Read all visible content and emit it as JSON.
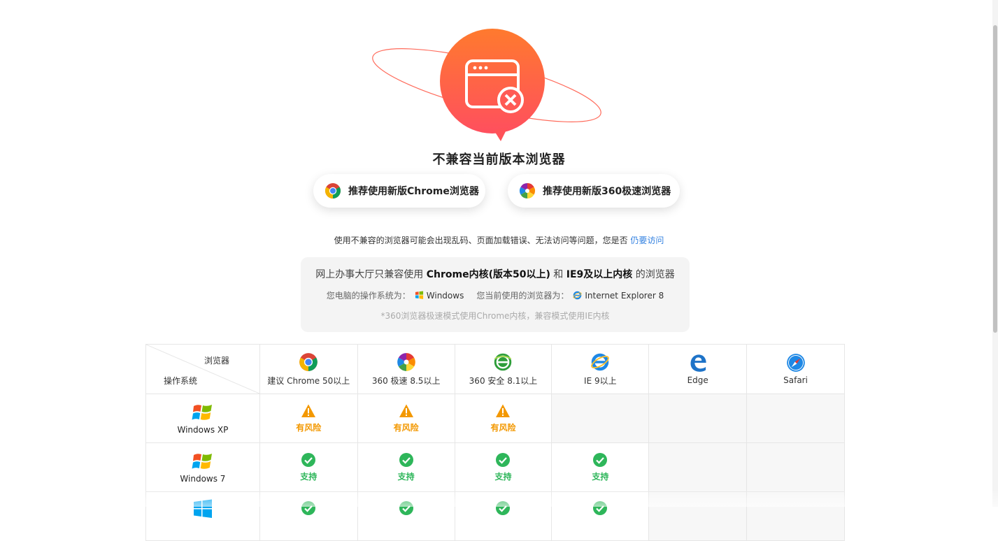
{
  "title": "不兼容当前版本浏览器",
  "buttons": {
    "chrome": "推荐使用新版Chrome浏览器",
    "b360": "推荐使用新版360极速浏览器"
  },
  "notice": {
    "text": "使用不兼容的浏览器可能会出现乱码、页面加载错误、无法访问等问题，您是否",
    "link": "仍要访问"
  },
  "info": {
    "pre": "网上办事大厅只兼容使用 ",
    "b1": "Chrome内核(版本50以上)",
    "mid": " 和 ",
    "b2": "IE9及以上内核",
    "post": " 的浏览器",
    "os_label": "您电脑的操作系统为：",
    "os_value": "Windows",
    "browser_label": "您当前使用的浏览器为：",
    "browser_value": "Internet Explorer 8",
    "footnote": "*360浏览器极速模式使用Chrome内核，兼容模式使用IE内核"
  },
  "table": {
    "corner_browser": "浏览器",
    "corner_os": "操作系统",
    "columns": [
      {
        "label": "建议 Chrome 50以上",
        "icon": "chrome-icon"
      },
      {
        "label": "360 极速 8.5以上",
        "icon": "360-speed-icon"
      },
      {
        "label": "360 安全 8.1以上",
        "icon": "360-safe-icon"
      },
      {
        "label": "IE 9以上",
        "icon": "ie-icon"
      },
      {
        "label": "Edge",
        "icon": "edge-icon"
      },
      {
        "label": "Safari",
        "icon": "safari-icon"
      }
    ],
    "rows": [
      {
        "os": "Windows XP",
        "cells": [
          "risk",
          "risk",
          "risk",
          "none",
          "none",
          "none"
        ]
      },
      {
        "os": "Windows 7",
        "cells": [
          "ok",
          "ok",
          "ok",
          "ok",
          "none",
          "none"
        ]
      },
      {
        "os": "",
        "cells": [
          "ok",
          "ok",
          "ok",
          "ok",
          "none",
          "none"
        ]
      }
    ],
    "risk_label": "有风险",
    "ok_label": "支持"
  },
  "colors": {
    "accent_orange": "#ff6a3d",
    "risk": "#f39800",
    "ok": "#2eb65a",
    "link": "#2f7fe0"
  }
}
